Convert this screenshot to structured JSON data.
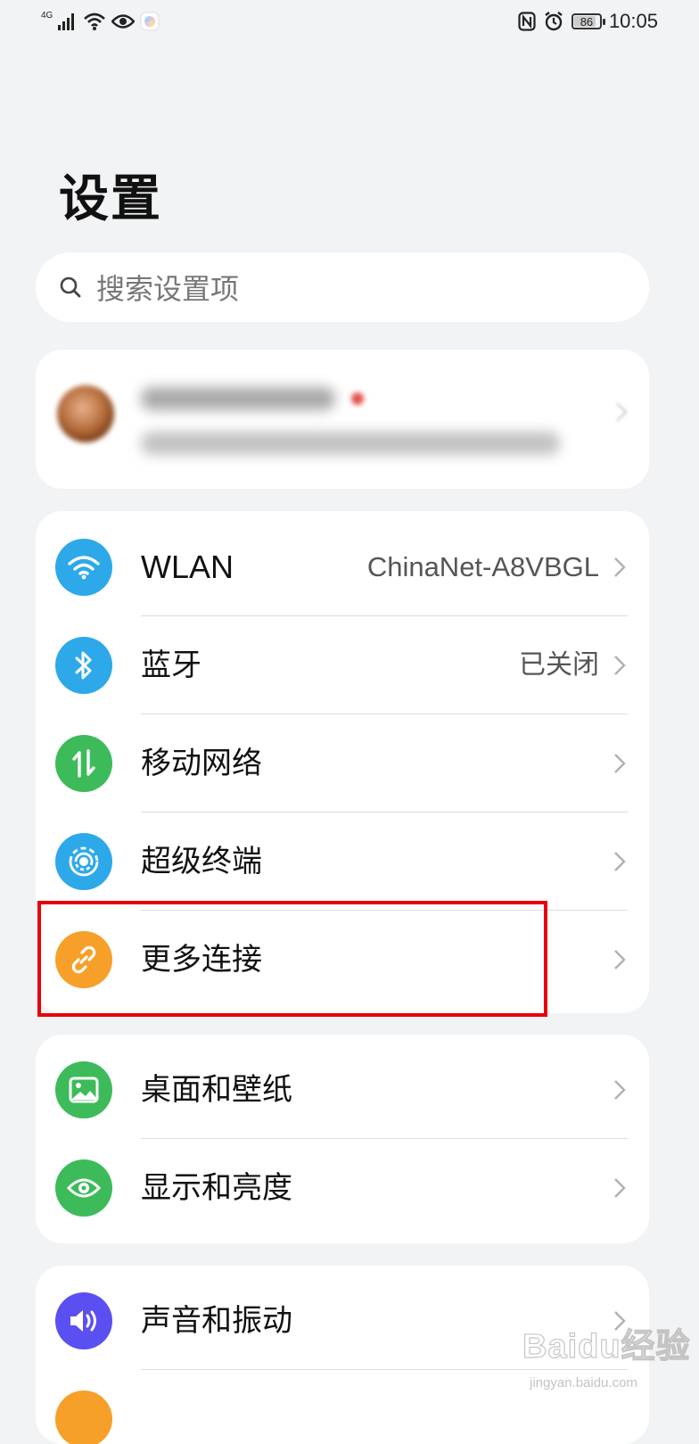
{
  "status_bar": {
    "network": "4G",
    "battery": "86",
    "battery_level_percent": 86,
    "time": "10:05",
    "icons": [
      "signal-icon",
      "wifi-icon",
      "eye-icon",
      "app-notification-icon",
      "nfc-icon",
      "alarm-icon",
      "battery-icon"
    ]
  },
  "page": {
    "title": "设置"
  },
  "search": {
    "placeholder": "搜索设置项"
  },
  "account": {
    "icons": [
      "avatar",
      "chevron-right-icon"
    ]
  },
  "groups": [
    {
      "items": [
        {
          "label": "WLAN",
          "value": "ChinaNet-A8VBGL",
          "icon": "wifi-icon",
          "color": "#2da9ea"
        },
        {
          "label": "蓝牙",
          "value": "已关闭",
          "icon": "bluetooth-icon",
          "color": "#2da9ea"
        },
        {
          "label": "移动网络",
          "value": "",
          "icon": "mobile-data-icon",
          "color": "#3dbb5b"
        },
        {
          "label": "超级终端",
          "value": "",
          "icon": "super-device-icon",
          "color": "#2da9ea"
        },
        {
          "label": "更多连接",
          "value": "",
          "icon": "link-icon",
          "color": "#f6a02a"
        }
      ]
    },
    {
      "items": [
        {
          "label": "桌面和壁纸",
          "value": "",
          "icon": "wallpaper-icon",
          "color": "#3dbb5b"
        },
        {
          "label": "显示和亮度",
          "value": "",
          "icon": "eye-icon",
          "color": "#3dbb5b"
        }
      ]
    },
    {
      "items": [
        {
          "label": "声音和振动",
          "value": "",
          "icon": "sound-icon",
          "color": "#5a4ff0"
        }
      ]
    }
  ],
  "highlight": {
    "target": "更多连接",
    "color": "#e8000c"
  },
  "watermark": {
    "main": "Baidu经验",
    "sub": "jingyan.baidu.com"
  }
}
